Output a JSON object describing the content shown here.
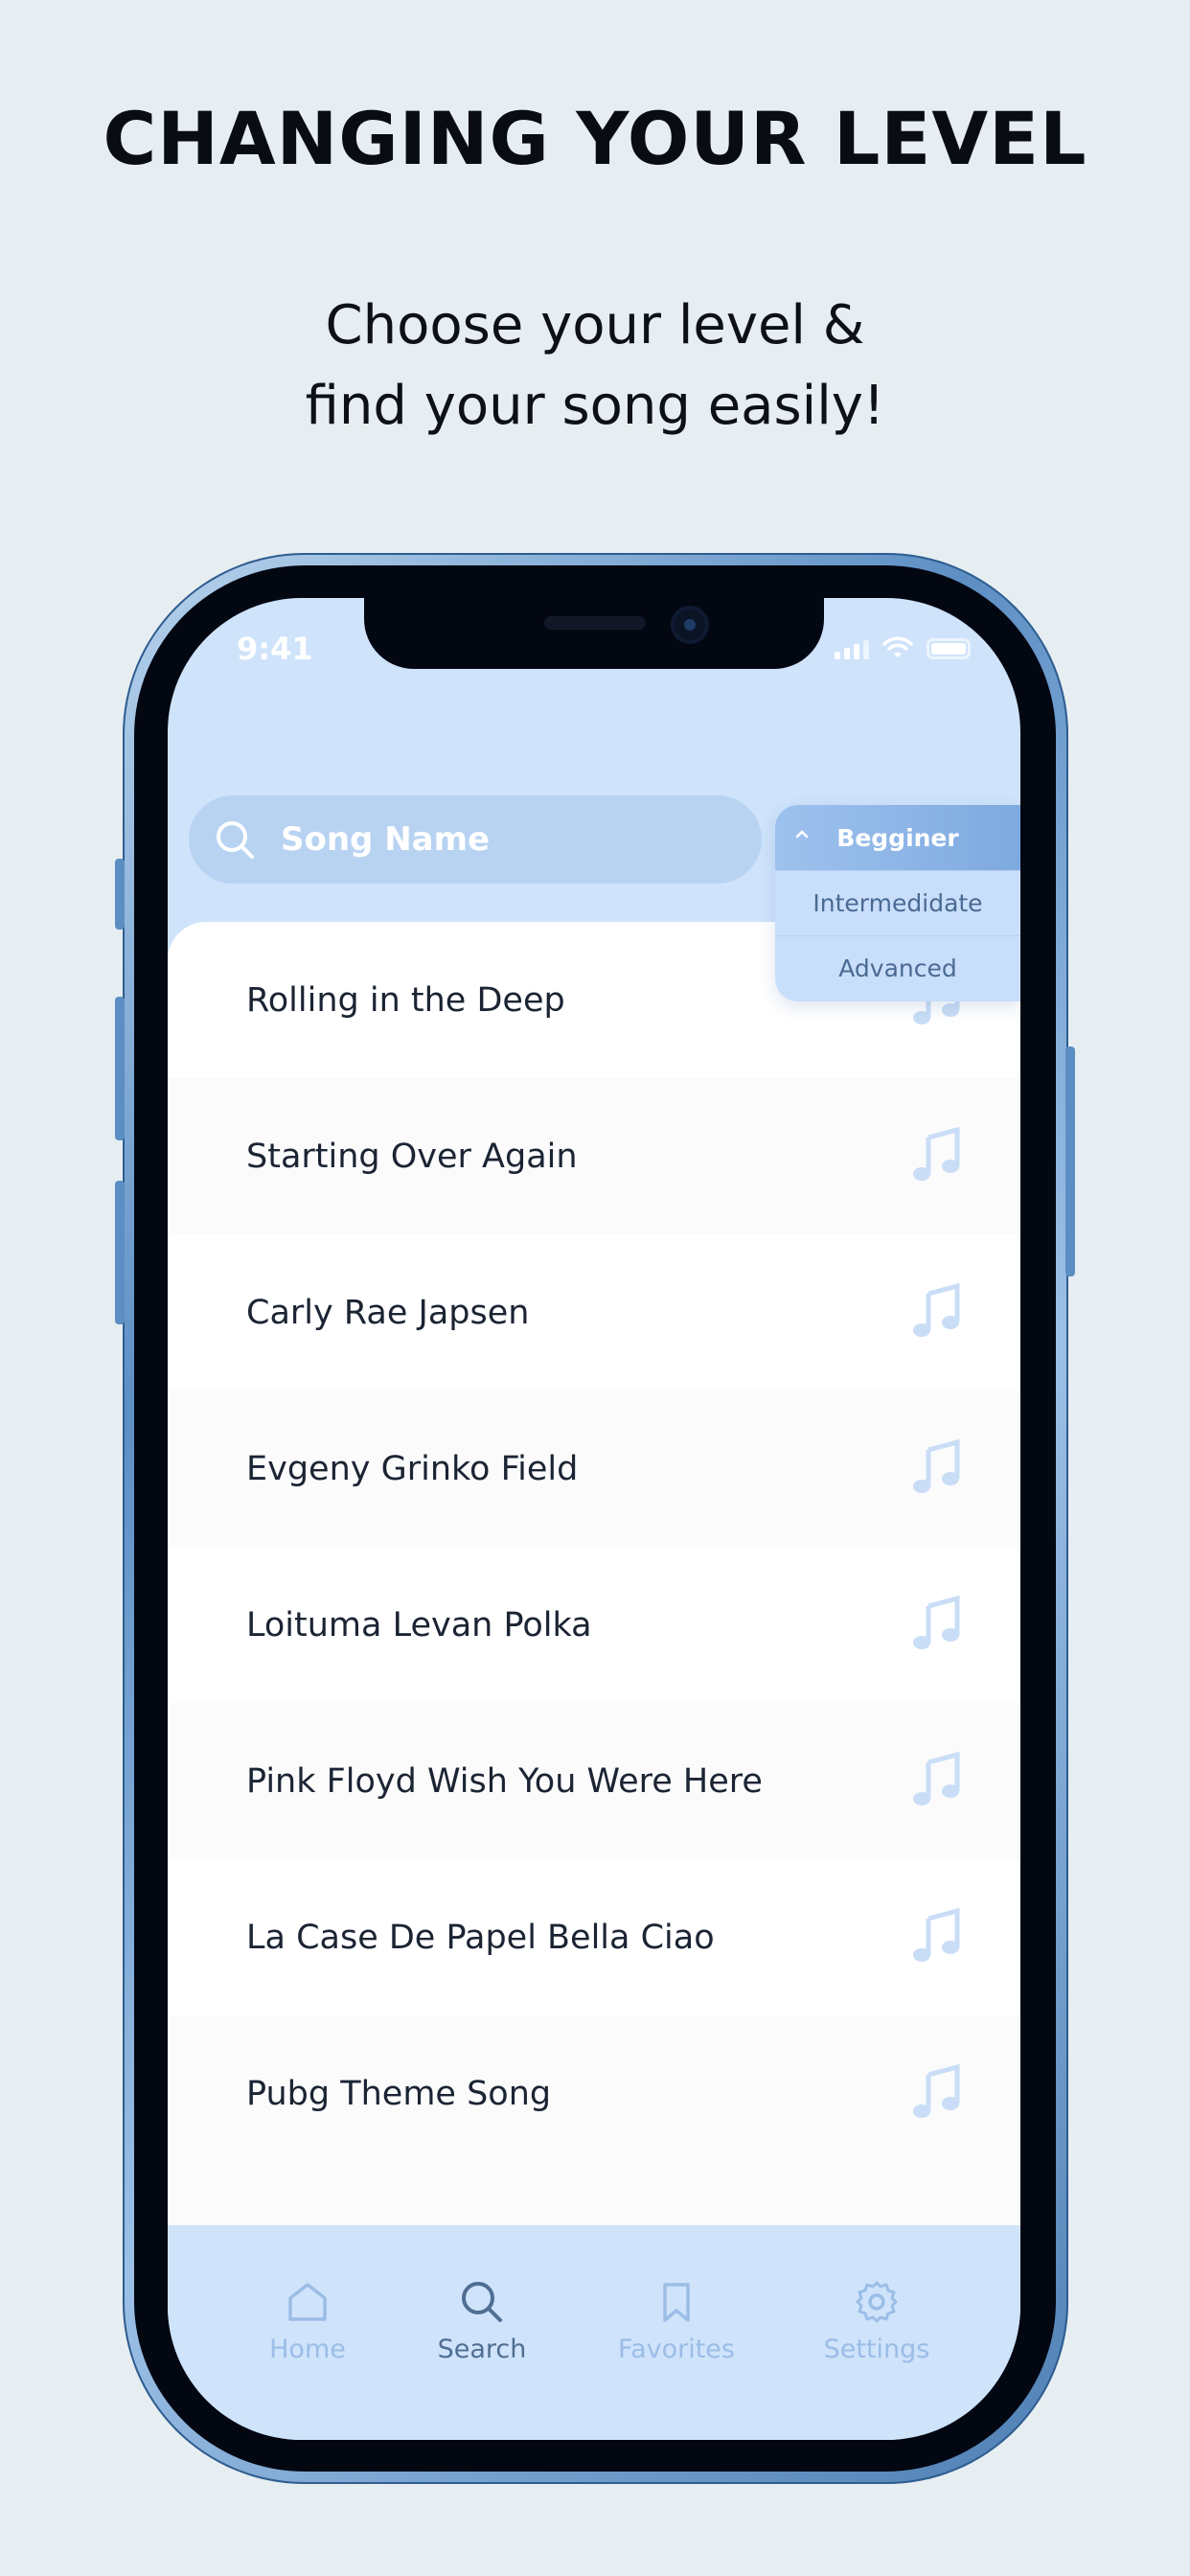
{
  "headline": "CHANGING YOUR LEVEL",
  "subheadline": [
    "Choose your level &",
    "find your song easily!"
  ],
  "status_bar": {
    "time": "9:41"
  },
  "search": {
    "placeholder": "Song Name"
  },
  "level_dropdown": {
    "selected": "Begginer",
    "options": [
      "Intermedidate",
      "Advanced"
    ]
  },
  "songs": [
    "Rolling in the Deep",
    "Starting Over Again",
    "Carly Rae Japsen",
    "Evgeny Grinko Field",
    "Loituma Levan Polka",
    "Pink Floyd Wish You Were Here",
    "La Case De Papel Bella Ciao",
    "Pubg Theme Song"
  ],
  "tabs": [
    {
      "label": "Home",
      "icon": "home-icon",
      "active": false
    },
    {
      "label": "Search",
      "icon": "search-icon",
      "active": true
    },
    {
      "label": "Favorites",
      "icon": "bookmark-icon",
      "active": false
    },
    {
      "label": "Settings",
      "icon": "gear-icon",
      "active": false
    }
  ],
  "colors": {
    "background": "#e7eef2",
    "screen": "#cfe3fb",
    "accent": "#7ea9df",
    "icon_light": "#c9ddf6"
  }
}
